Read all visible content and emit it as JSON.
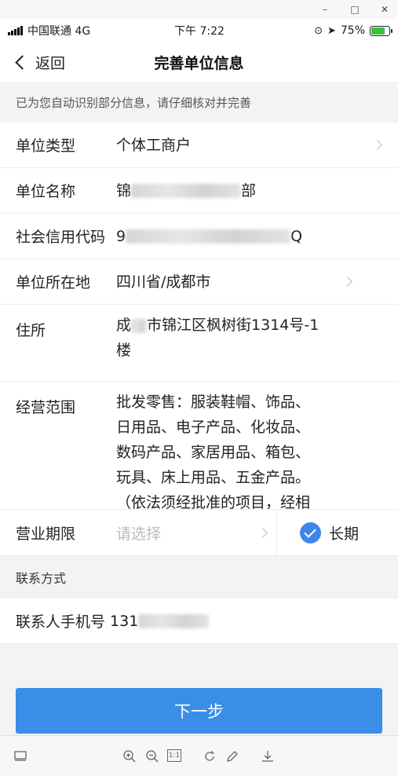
{
  "window": {
    "minimize": "–",
    "maximize": "□",
    "close": "✕"
  },
  "status_bar": {
    "carrier": "中国联通 4G",
    "time": "下午 7:22",
    "battery": "75%"
  },
  "nav": {
    "back_label": "返回",
    "title": "完善单位信息"
  },
  "notice": "已为您自动识别部分信息，请仔细核对并完善",
  "fields": {
    "unit_type": {
      "label": "单位类型",
      "value": "个体工商户"
    },
    "unit_name": {
      "label": "单位名称",
      "value_prefix": "锦",
      "value_suffix": "部"
    },
    "credit_code": {
      "label": "社会信用代码",
      "value_prefix": "9",
      "value_suffix": "Q"
    },
    "location": {
      "label": "单位所在地",
      "value": "四川省/成都市"
    },
    "address": {
      "label": "住所",
      "line1_prefix": "成",
      "line1_suffix": "市锦江区枫树街1314号-1",
      "line2": "楼"
    },
    "business_scope": {
      "label": "经营范围",
      "lines": [
        "批发零售：服装鞋帽、饰品、",
        "日用品、电子产品、化妆品、",
        "数码产品、家居用品、箱包、",
        "玩具、床上用品、五金产品。",
        "（依法须经批准的项目，经相"
      ]
    },
    "period": {
      "label": "营业期限",
      "placeholder": "请选择",
      "long_term": "长期"
    }
  },
  "contact": {
    "section_title": "联系方式",
    "phone_label": "联系人手机号",
    "phone_prefix": "131"
  },
  "next_button": "下一步",
  "colors": {
    "accent": "#3a8ee8",
    "check": "#3e87e8"
  },
  "viewer_icons": [
    "screen-icon",
    "zoom-in-icon",
    "zoom-out-icon",
    "actual-size-icon",
    "rotate-icon",
    "edit-icon",
    "download-icon"
  ],
  "viewer_actual_size_text": "1:1"
}
